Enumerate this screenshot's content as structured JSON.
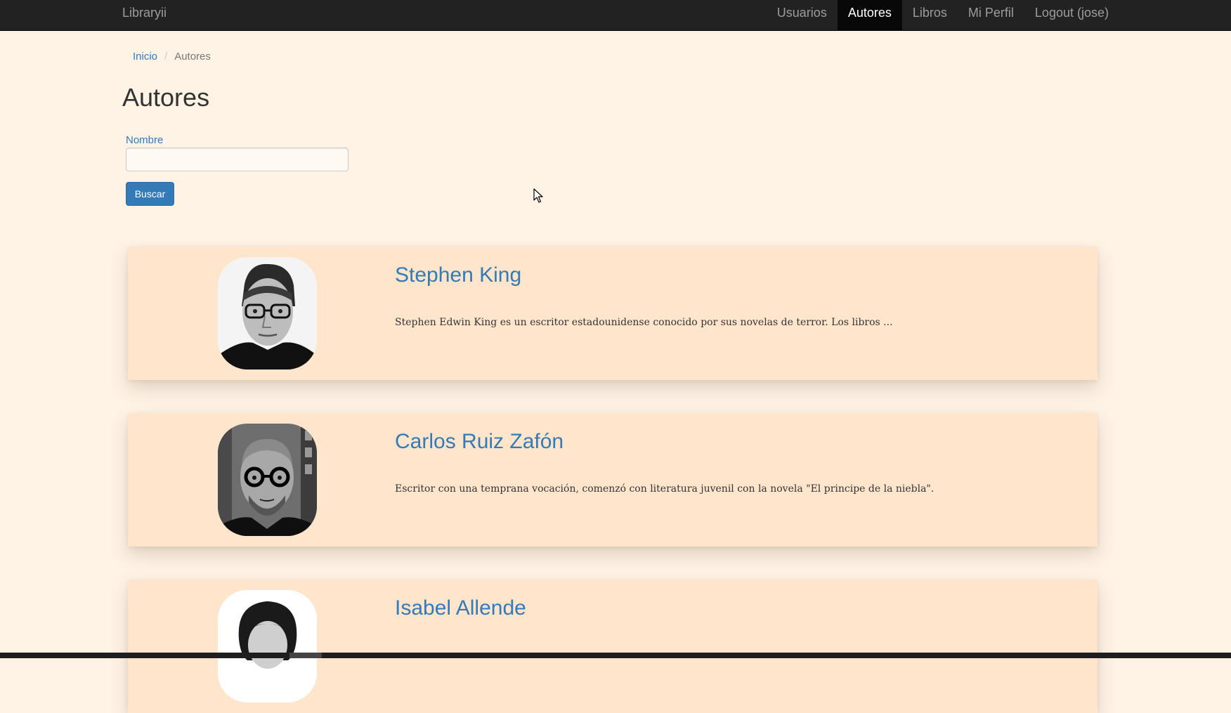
{
  "navbar": {
    "brand": "Libraryii",
    "items": [
      {
        "label": "Usuarios",
        "active": false
      },
      {
        "label": "Autores",
        "active": true
      },
      {
        "label": "Libros",
        "active": false
      },
      {
        "label": "Mi Perfil",
        "active": false
      },
      {
        "label": "Logout (jose)",
        "active": false
      }
    ]
  },
  "breadcrumb": {
    "home": "Inicio",
    "separator": "/",
    "current": "Autores"
  },
  "page": {
    "title": "Autores"
  },
  "search": {
    "label": "Nombre",
    "value": "",
    "placeholder": "",
    "button": "Buscar"
  },
  "authors": [
    {
      "name": "Stephen King",
      "description": "Stephen Edwin King es un escritor estadounidense conocido por sus novelas de terror. Los libros ..."
    },
    {
      "name": "Carlos Ruiz Zafón",
      "description": "Escritor con una temprana vocación, comenzó con literatura juvenil con la novela \"El principe de la niebla\"."
    },
    {
      "name": "Isabel Allende",
      "description": ""
    }
  ],
  "colors": {
    "background": "#fff3e6",
    "card": "#ffe5cc",
    "navbar": "#222222",
    "link": "#337ab7",
    "primary_button": "#337ab7"
  }
}
